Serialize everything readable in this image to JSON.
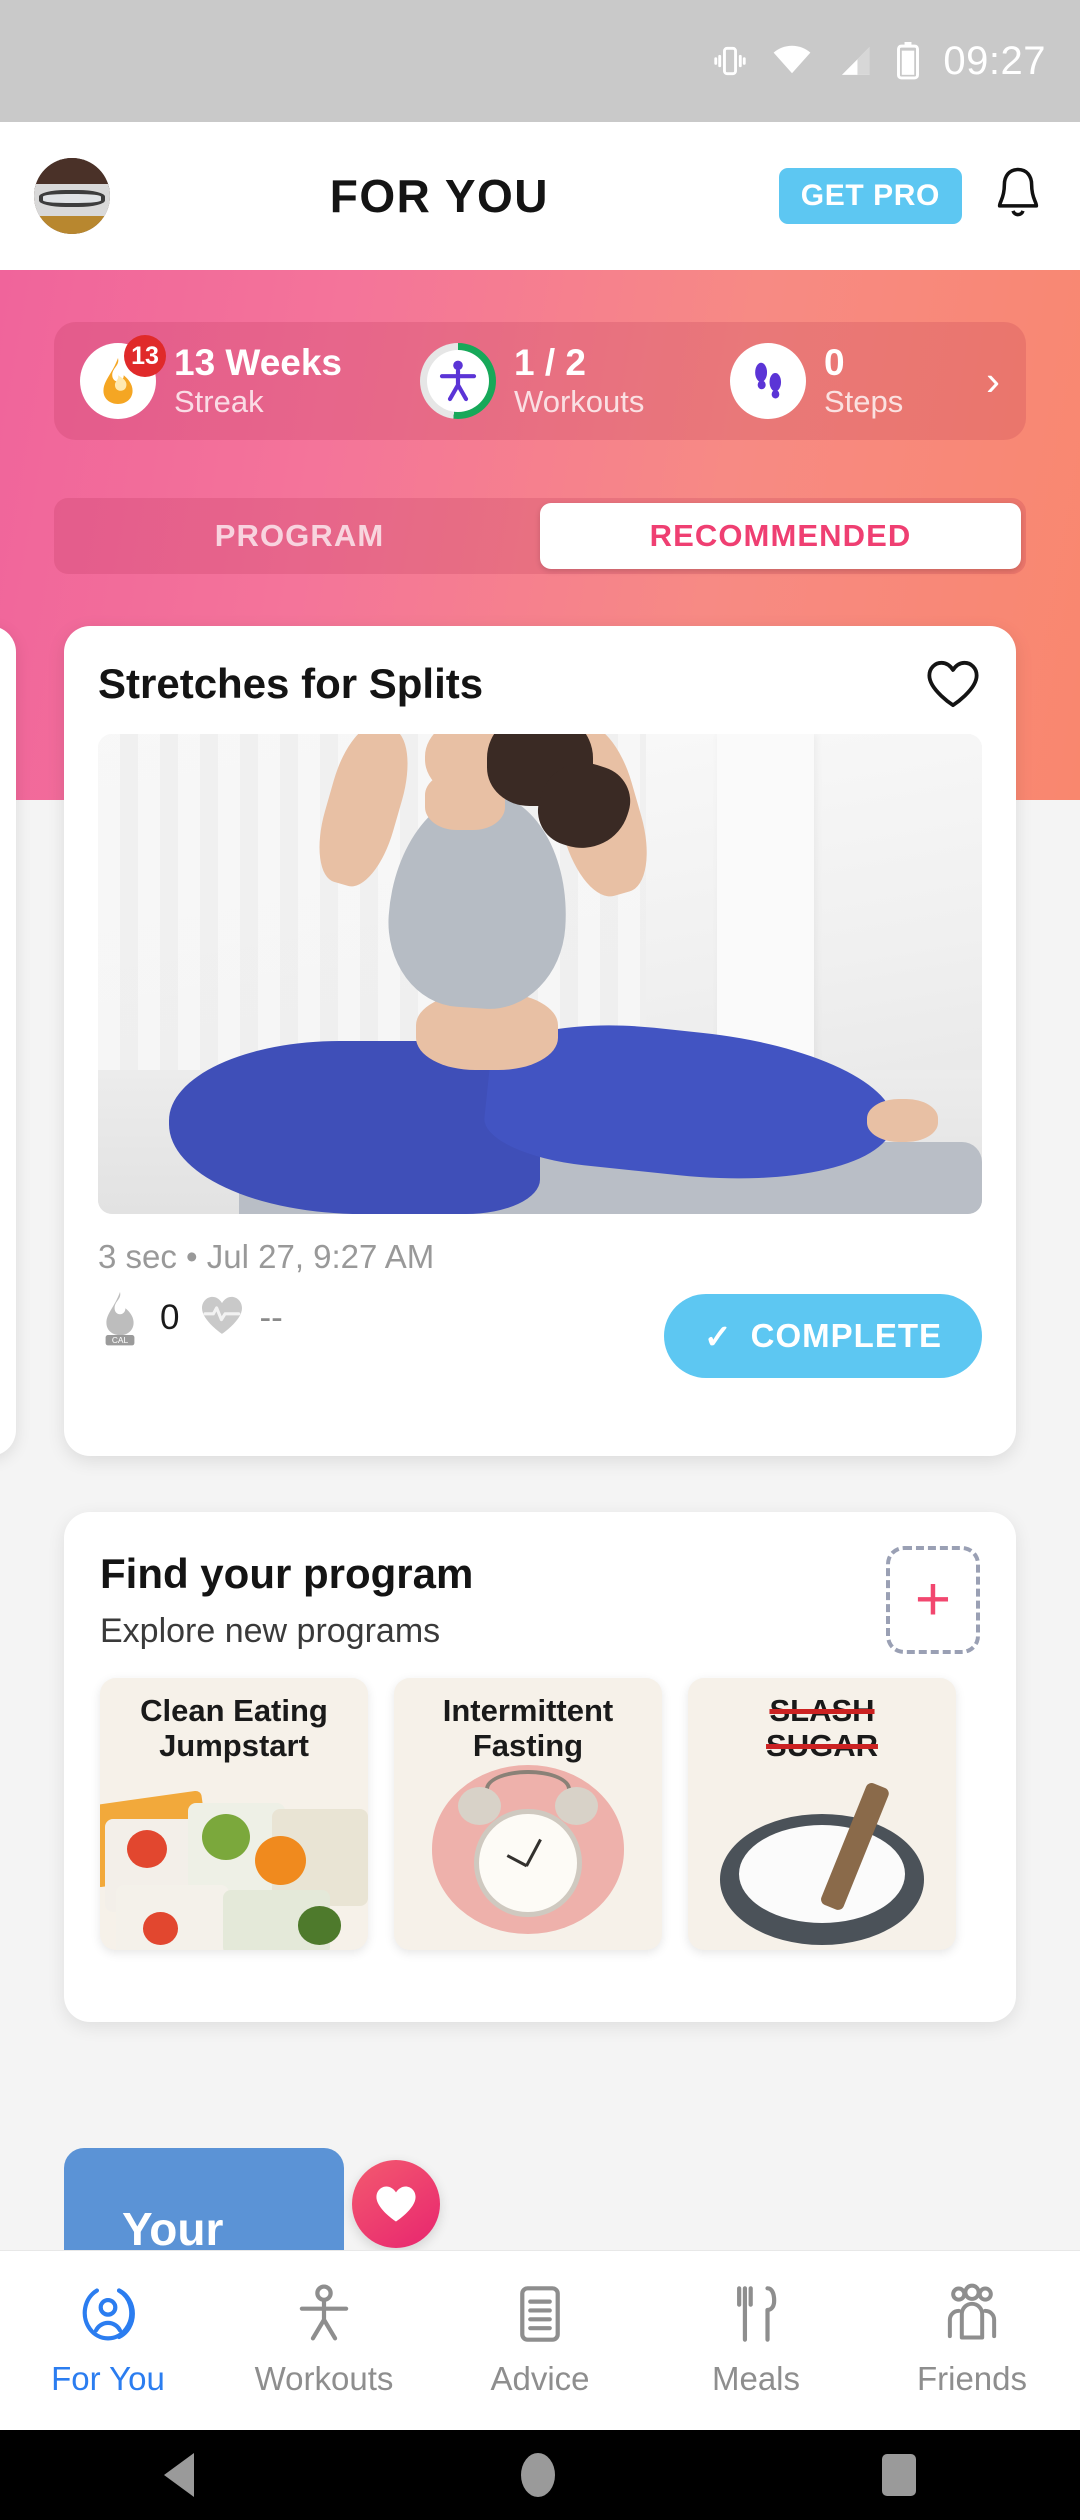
{
  "status_bar": {
    "time": "09:27",
    "icons": [
      "vibrate-icon",
      "wifi-icon",
      "signal-icon",
      "battery-icon"
    ]
  },
  "header": {
    "title": "FOR YOU",
    "get_pro_label": "GET PRO",
    "avatar_name": "user-avatar",
    "notification_icon": "bell-icon"
  },
  "stats": {
    "streak": {
      "value": "13 Weeks",
      "label": "Streak",
      "badge": "13",
      "icon": "flame-icon"
    },
    "workouts": {
      "value": "1 / 2",
      "label": "Workouts",
      "icon": "exercise-person-icon",
      "progress_percent": 50
    },
    "steps": {
      "value": "0",
      "label": "Steps",
      "icon": "footprints-icon"
    },
    "chevron": "›"
  },
  "tabs": {
    "program_label": "PROGRAM",
    "recommended_label": "RECOMMENDED",
    "active": "RECOMMENDED"
  },
  "workout_card": {
    "title": "Stretches for Splits",
    "favorite_icon": "heart-outline-icon",
    "meta": "3 sec • Jul 27, 9:27 AM",
    "calories_value": "0",
    "calories_icon": "calorie-flame-icon",
    "heart_rate_value": "--",
    "heart_rate_icon": "heart-rate-icon",
    "complete_label": "COMPLETE",
    "complete_check": "✓",
    "image_alt": "woman-doing-splits-stretch"
  },
  "program_section": {
    "title": "Find your program",
    "subtitle": "Explore new programs",
    "add_label": "+",
    "thumbnails": [
      {
        "line1": "Clean Eating",
        "line2": "Jumpstart",
        "struck": "",
        "name": "program-clean-eating-jumpstart"
      },
      {
        "line1": "Intermittent",
        "line2": "Fasting",
        "struck": "",
        "name": "program-intermittent-fasting"
      },
      {
        "line1": "SLASH",
        "line2": "",
        "struck": "SUGAR",
        "name": "program-slash-sugar"
      }
    ]
  },
  "teaser_card": {
    "title": "Your",
    "badge_icon": "heart-filled-icon"
  },
  "bottom_nav": {
    "items": [
      {
        "label": "For You",
        "icon": "person-circle-icon",
        "active": true
      },
      {
        "label": "Workouts",
        "icon": "exercise-person-icon",
        "active": false
      },
      {
        "label": "Advice",
        "icon": "document-icon",
        "active": false
      },
      {
        "label": "Meals",
        "icon": "fork-knife-icon",
        "active": false
      },
      {
        "label": "Friends",
        "icon": "people-group-icon",
        "active": false
      }
    ]
  },
  "android_nav": {
    "back": "back-triangle-icon",
    "home": "home-circle-icon",
    "recents": "recents-square-icon"
  },
  "colors": {
    "gradient_start": "#F0649B",
    "gradient_end": "#F9876E",
    "accent_pink": "#EF3F72",
    "accent_blue": "#5DC7F2",
    "nav_active_blue": "#2B7DF0",
    "streak_badge_red": "#E02A2A",
    "progress_green": "#17A859",
    "page_background": "#F4F4F4"
  }
}
